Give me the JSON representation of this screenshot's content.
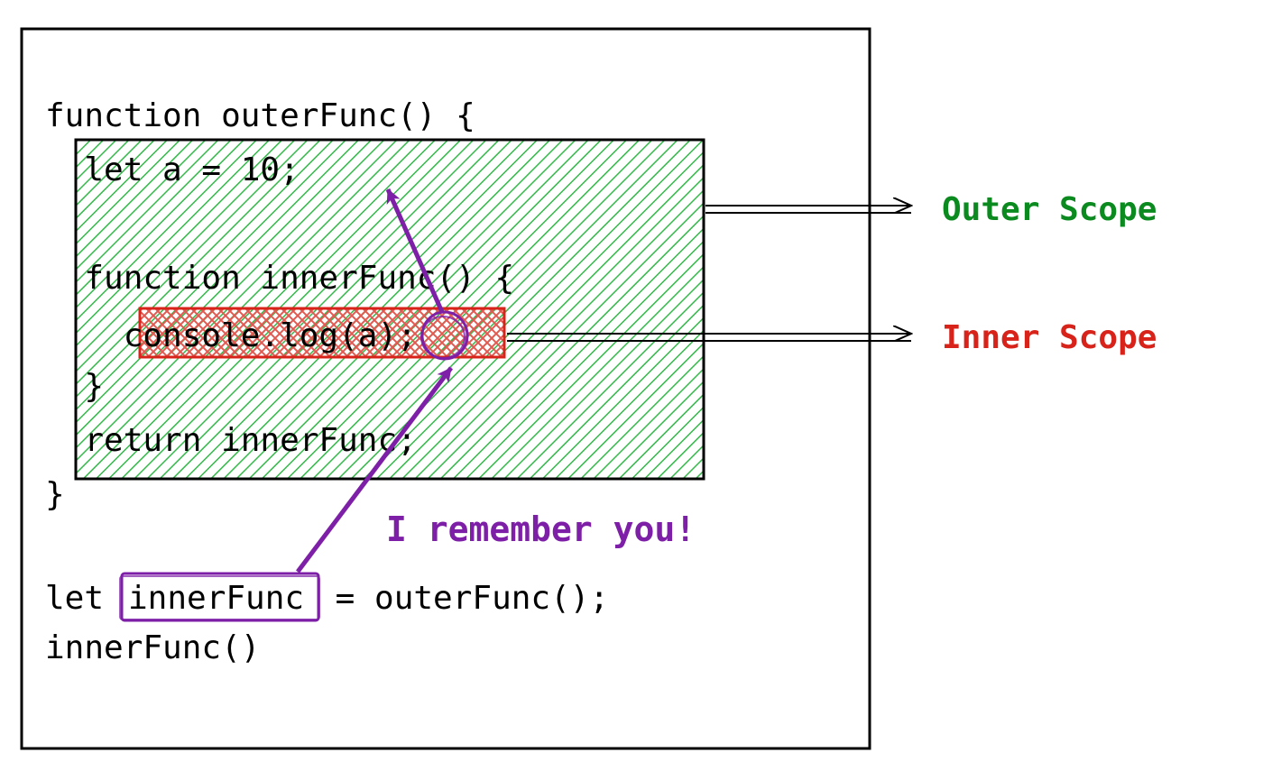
{
  "code": {
    "line1": "function outerFunc() {",
    "line2": "  let a = 10;",
    "line3": "  function innerFunc() {",
    "line4": "    console.log(a);",
    "line5": "  }",
    "line6": "  return innerFunc;",
    "line7": "}",
    "line8_a": "let ",
    "line8_b": "innerFunc",
    "line8_c": " = outerFunc();",
    "line9": "innerFunc()"
  },
  "labels": {
    "outerScope": "Outer Scope",
    "innerScope": "Inner Scope",
    "remember": "I remember you!"
  },
  "colors": {
    "outerScope": "#0a8a1f",
    "innerScope": "#d8231a",
    "purple": "#7e1fa7",
    "greenFill": "#1fa82f",
    "redFill": "#d8231a",
    "black": "#000000"
  }
}
